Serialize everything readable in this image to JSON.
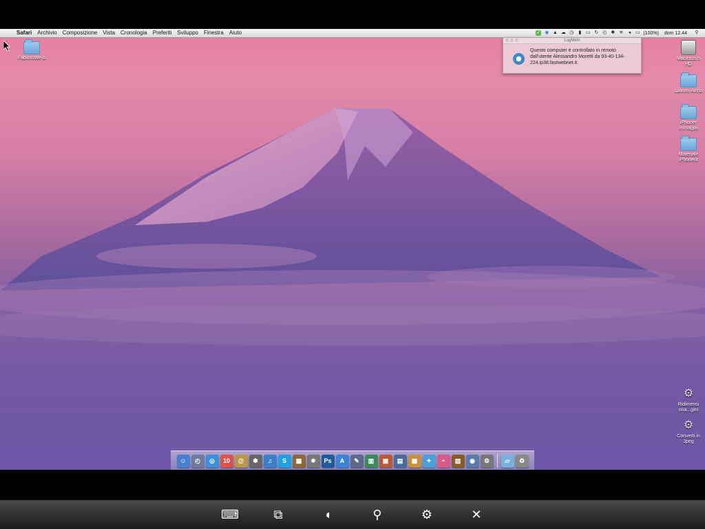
{
  "menubar": {
    "apple_glyph": "",
    "app_name": "Safari",
    "items": [
      "Archivio",
      "Composizione",
      "Vista",
      "Cronologia",
      "Preferiti",
      "Sviluppo",
      "Finestra",
      "Aiuto"
    ],
    "battery": "(100%)",
    "clock": "dom 12.44"
  },
  "desktop_icons": {
    "top_left": "FabioroWe b",
    "macintosh_hd": "Macintos h HD",
    "lavoro": "Lavoro Arrco",
    "iphoner_immagini": "iPhoner immagini",
    "materiale_iphoner": "Materiale iPhonerit",
    "ridimensiona": "Ridimensi ona...gini",
    "converti": "Converti in Jpeg"
  },
  "notification": {
    "title": "LogMeIn",
    "message": "Questo computer è controllato in remoto dall'utente Alessandro Moretti da 93-40-134-224.ip38.fastwebnet.it."
  },
  "dock": {
    "apps": [
      {
        "name": "finder",
        "glyph": "☺",
        "color": "#4a7fd0"
      },
      {
        "name": "dashboard",
        "glyph": "◴",
        "color": "#6c7c9a"
      },
      {
        "name": "safari",
        "glyph": "◎",
        "color": "#3a8fd8"
      },
      {
        "name": "calendar",
        "glyph": "10",
        "color": "#d9534f"
      },
      {
        "name": "address-book",
        "glyph": "@",
        "color": "#b8964a"
      },
      {
        "name": "photo-booth",
        "glyph": "✽",
        "color": "#666"
      },
      {
        "name": "itunes",
        "glyph": "♫",
        "color": "#3c7fc8"
      },
      {
        "name": "skype",
        "glyph": "S",
        "color": "#1fa0e3"
      },
      {
        "name": "iphoto",
        "glyph": "▦",
        "color": "#8a6a3a"
      },
      {
        "name": "utility",
        "glyph": "✸",
        "color": "#777"
      },
      {
        "name": "photoshop",
        "glyph": "Ps",
        "color": "#1c5c9a"
      },
      {
        "name": "app-store",
        "glyph": "A",
        "color": "#3b84d4"
      },
      {
        "name": "editor",
        "glyph": "✎",
        "color": "#5a6a8a"
      },
      {
        "name": "activity-monitor",
        "glyph": "▥",
        "color": "#3a8a5a"
      },
      {
        "name": "preview",
        "glyph": "▣",
        "color": "#b65a3a"
      },
      {
        "name": "storage",
        "glyph": "▤",
        "color": "#4a6a9a"
      },
      {
        "name": "packager",
        "glyph": "▩",
        "color": "#c8903a"
      },
      {
        "name": "twitter",
        "glyph": "✦",
        "color": "#4aa0d8"
      },
      {
        "name": "messenger",
        "glyph": "◓",
        "color": "#d85a8a"
      },
      {
        "name": "archive",
        "glyph": "▧",
        "color": "#8a5a2a"
      },
      {
        "name": "network",
        "glyph": "◉",
        "color": "#5a7aaa"
      },
      {
        "name": "preferences",
        "glyph": "⚙",
        "color": "#777"
      }
    ],
    "stack_glyph": "▱",
    "trash_glyph": "♻"
  },
  "toolbar": {
    "keyboard_glyph": "⌨",
    "network_glyph": "⧉",
    "mouse_glyph": "◖",
    "zoom_glyph": "⚲",
    "settings_glyph": "⚙",
    "close_glyph": "✕"
  }
}
